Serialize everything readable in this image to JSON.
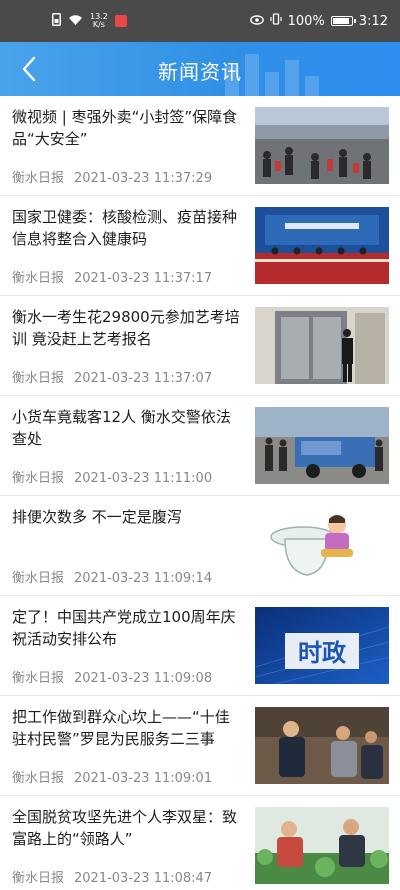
{
  "status_bar": {
    "speed_value": "13.2",
    "speed_unit": "K/s",
    "battery": "100%",
    "time": "3:12"
  },
  "header": {
    "title": "新闻资讯",
    "back_icon": "chevron-left-icon"
  },
  "colors": {
    "header_start": "#4aa3ea",
    "header_end": "#2e8ef0",
    "status_bar": "#4a4a4a"
  },
  "news": [
    {
      "title": "微视频 | 枣强外卖“小封签”保障食品“大安全”",
      "source": "衡水日报",
      "time": "2021-03-23 11:37:29"
    },
    {
      "title": "国家卫健委：核酸检测、疫苗接种信息将整合入健康码",
      "source": "衡水日报",
      "time": "2021-03-23 11:37:17"
    },
    {
      "title": "衡水一考生花29800元参加艺考培训 竟没赶上艺考报名",
      "source": "衡水日报",
      "time": "2021-03-23 11:37:07"
    },
    {
      "title": "小货车竟载客12人 衡水交警依法查处",
      "source": "衡水日报",
      "time": "2021-03-23 11:11:00"
    },
    {
      "title": "排便次数多 不一定是腹泻",
      "source": "衡水日报",
      "time": "2021-03-23 11:09:14"
    },
    {
      "title": "定了！中国共产党成立100周年庆祝活动安排公布",
      "source": "衡水日报",
      "time": "2021-03-23 11:09:08",
      "thumb_text": "时政"
    },
    {
      "title": "把工作做到群众心坎上——“十佳驻村民警”罗昆为民服务二三事",
      "source": "衡水日报",
      "time": "2021-03-23 11:09:01"
    },
    {
      "title": "全国脱贫攻坚先进个人李双星：致富路上的“领路人”",
      "source": "衡水日报",
      "time": "2021-03-23 11:08:47"
    }
  ]
}
